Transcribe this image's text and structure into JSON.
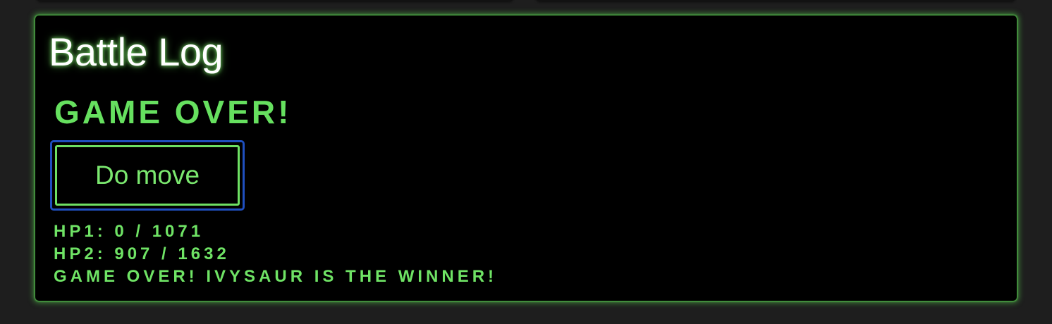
{
  "panel": {
    "title": "Battle Log",
    "status_heading": "GAME OVER!",
    "move_button_label": "Do move",
    "log_lines": [
      "HP1: 0 / 1071",
      "HP2: 907 / 1632",
      "GAME OVER! IVYSAUR IS THE WINNER!"
    ]
  },
  "colors": {
    "background": "#1e1e1e",
    "panel": "#000000",
    "accent_green": "#6ee063",
    "focus_ring": "#1f4fbf",
    "title_text": "#ffffff"
  }
}
